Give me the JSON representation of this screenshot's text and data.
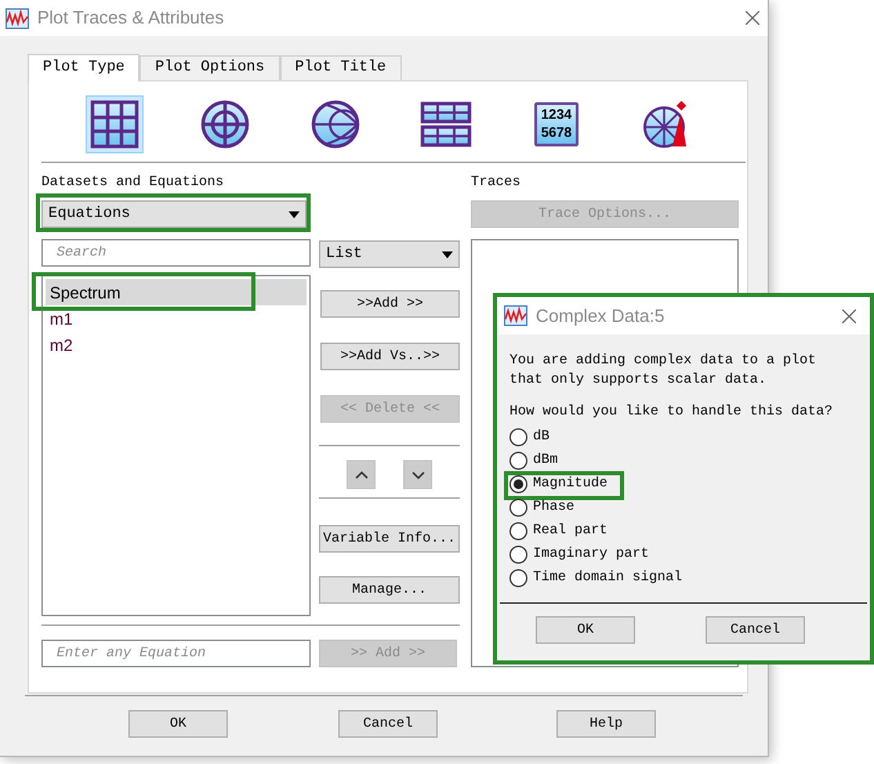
{
  "window": {
    "title": "Plot Traces & Attributes"
  },
  "tabs": [
    {
      "label": "Plot Type",
      "selected": true
    },
    {
      "label": "Plot Options",
      "selected": false
    },
    {
      "label": "Plot Title",
      "selected": false
    }
  ],
  "plot_types": [
    {
      "kind": "rectangular",
      "selected": true
    },
    {
      "kind": "polar",
      "selected": false
    },
    {
      "kind": "smith",
      "selected": false
    },
    {
      "kind": "stacked",
      "selected": false
    },
    {
      "kind": "tabular",
      "selected": false,
      "lines": [
        "1234",
        "5678"
      ]
    },
    {
      "kind": "antenna",
      "selected": false
    }
  ],
  "datasets": {
    "label": "Datasets and Equations",
    "dropdown": {
      "value": "Equations",
      "highlighted": true
    },
    "search_placeholder": "Search",
    "view_dropdown": "List",
    "items": [
      {
        "name": "Spectrum",
        "selected": true,
        "highlighted": true
      },
      {
        "name": "m1",
        "selected": false,
        "highlighted": false
      },
      {
        "name": "m2",
        "selected": false,
        "highlighted": false
      }
    ],
    "equation_placeholder": "Enter any Equation",
    "add_button": {
      "label": ">> Add >>",
      "disabled": true
    }
  },
  "actions": [
    {
      "label": ">>Add >>",
      "disabled": false
    },
    {
      "label": ">>Add Vs..>>",
      "disabled": false
    },
    {
      "label": "<< Delete <<",
      "disabled": true
    }
  ],
  "tools": [
    {
      "label": "Variable Info...",
      "disabled": false
    },
    {
      "label": "Manage...",
      "disabled": false
    }
  ],
  "traces": {
    "label": "Traces",
    "options_button": {
      "label": "Trace Options...",
      "disabled": true
    }
  },
  "footer": [
    "OK",
    "Cancel",
    "Help"
  ],
  "dialog": {
    "title": "Complex Data:5",
    "highlighted": true,
    "message": "You are adding complex data to a plot that only supports scalar data.",
    "question": "How would you like to handle this data?",
    "options": [
      {
        "label": "dB",
        "selected": false,
        "highlighted": false
      },
      {
        "label": "dBm",
        "selected": false,
        "highlighted": false
      },
      {
        "label": "Magnitude",
        "selected": true,
        "highlighted": true
      },
      {
        "label": "Phase",
        "selected": false,
        "highlighted": false
      },
      {
        "label": "Real part",
        "selected": false,
        "highlighted": false
      },
      {
        "label": "Imaginary part",
        "selected": false,
        "highlighted": false
      },
      {
        "label": "Time domain signal",
        "selected": false,
        "highlighted": false
      }
    ],
    "buttons": [
      "OK",
      "Cancel"
    ]
  }
}
